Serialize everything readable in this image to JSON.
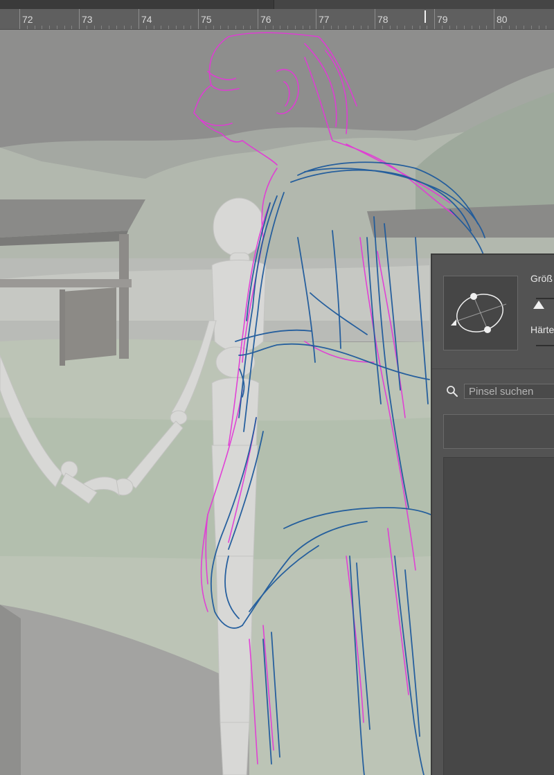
{
  "ruler": {
    "labels": [
      "72",
      "73",
      "74",
      "75",
      "76",
      "77",
      "78",
      "79",
      "80"
    ]
  },
  "brush_panel": {
    "size_label": "Größ",
    "hardness_label": "Härte",
    "search_placeholder": "Pinsel suchen",
    "preview_icon": "brush-angle-roundness-icon",
    "search_icon": "search-icon"
  },
  "colors": {
    "sketch_pink": "#e23ad6",
    "sketch_blue": "#1e5a9c",
    "panel_bg": "#535353",
    "ruler_bg": "#5f5f5f"
  }
}
